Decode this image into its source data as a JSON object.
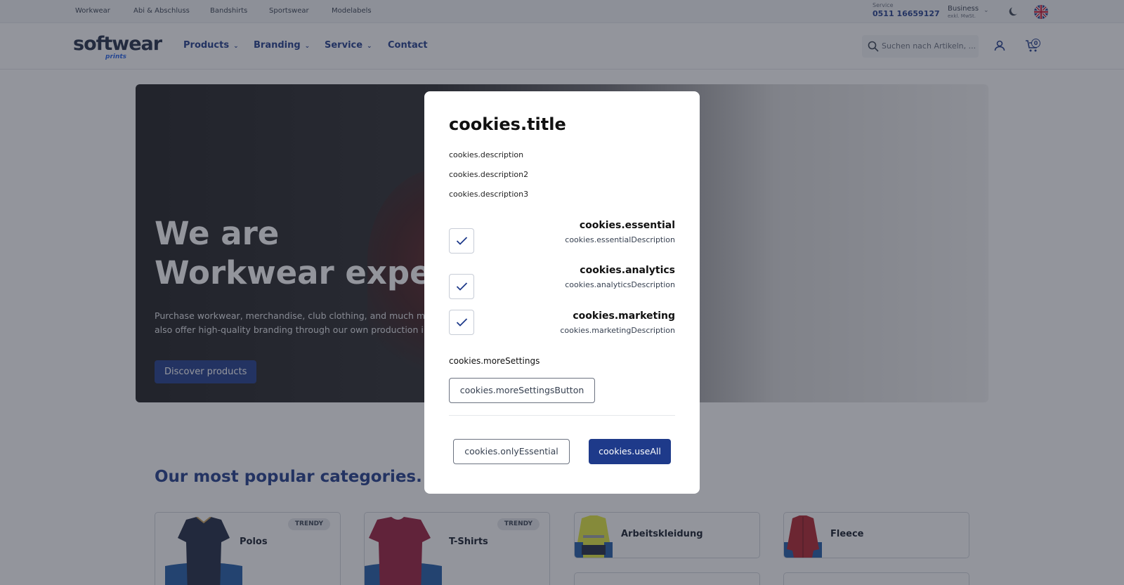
{
  "topbar": {
    "links": [
      "Workwear",
      "Abi & Abschluss",
      "Bandshirts",
      "Sportswear",
      "Modelabels"
    ],
    "service_label": "Service",
    "service_phone": "0511 16659127",
    "business_label": "Business",
    "business_sub": "exkl. MwSt."
  },
  "header": {
    "logo_main": "softwear",
    "logo_sub": "prints",
    "nav": [
      "Products",
      "Branding",
      "Service",
      "Contact"
    ],
    "search_placeholder": "Suchen nach Artikeln, ...",
    "cart_count": "0"
  },
  "hero": {
    "title_line1": "We are",
    "title_line2": "Workwear expert",
    "desc_line1": "Purchase workwear, merchandise, club clothing, and much more",
    "desc_line2": "also offer high-quality branding through our own production in",
    "button": "Discover products"
  },
  "categories": {
    "heading": "Our most popular categories.",
    "items": [
      {
        "name": "Polos",
        "badge": "TRENDY"
      },
      {
        "name": "T-Shirts",
        "badge": "TRENDY"
      },
      {
        "name": "Arbeitskleidung",
        "badge": ""
      },
      {
        "name": "Fleece",
        "badge": ""
      }
    ]
  },
  "cookies": {
    "title": "cookies.title",
    "description": "cookies.description",
    "description2": "cookies.description2",
    "description3": "cookies.description3",
    "options": [
      {
        "title": "cookies.essential",
        "desc": "cookies.essentialDescription",
        "checked": true
      },
      {
        "title": "cookies.analytics",
        "desc": "cookies.analyticsDescription",
        "checked": true
      },
      {
        "title": "cookies.marketing",
        "desc": "cookies.marketingDescription",
        "checked": true
      }
    ],
    "more_settings": "cookies.moreSettings",
    "more_settings_button": "cookies.moreSettingsButton",
    "only_essential": "cookies.onlyEssential",
    "use_all": "cookies.useAll"
  },
  "colors": {
    "brand_blue": "#1e3a8a",
    "overlay": "rgba(40,44,58,0.5)"
  }
}
